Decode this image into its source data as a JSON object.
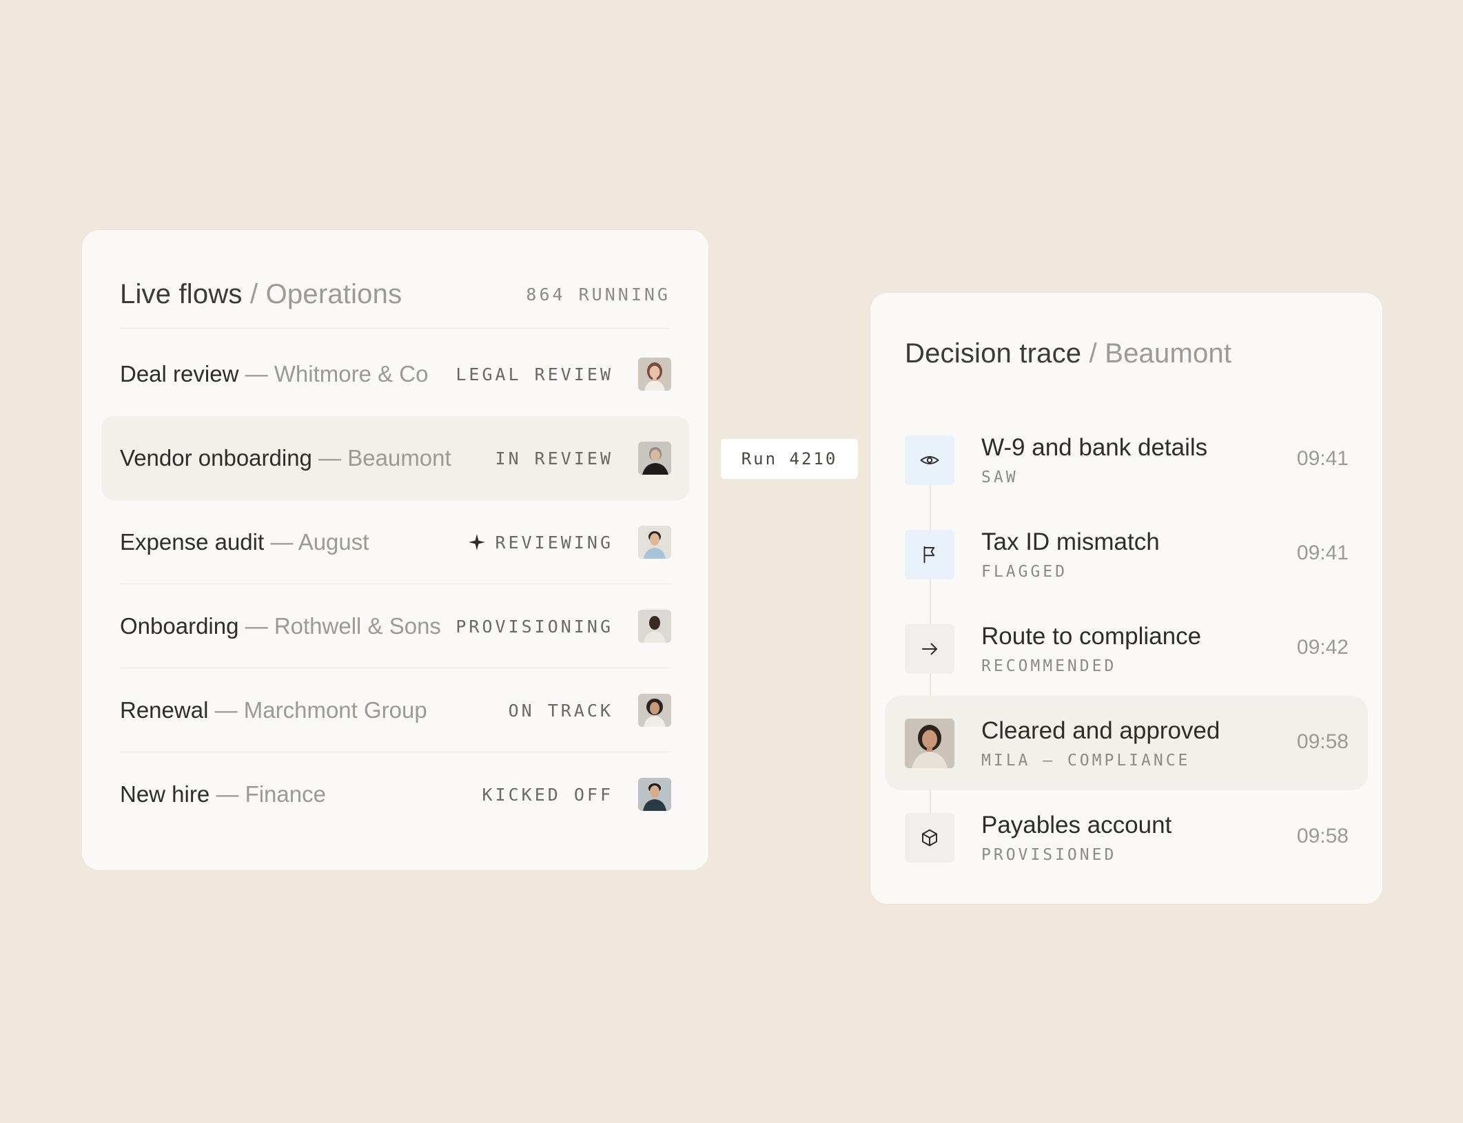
{
  "flows": {
    "title": "Live flows",
    "separator": "/",
    "subtitle": "Operations",
    "running_count": "864 RUNNING",
    "items": [
      {
        "name": "Deal review",
        "dash": "—",
        "org": "Whitmore & Co",
        "status": "LEGAL REVIEW"
      },
      {
        "name": "Vendor onboarding",
        "dash": "—",
        "org": "Beaumont",
        "status": "IN REVIEW"
      },
      {
        "name": "Expense audit",
        "dash": "—",
        "org": "August",
        "status": "REVIEWING"
      },
      {
        "name": "Onboarding",
        "dash": "—",
        "org": "Rothwell & Sons",
        "status": "PROVISIONING"
      },
      {
        "name": "Renewal",
        "dash": "—",
        "org": "Marchmont Group",
        "status": "ON TRACK"
      },
      {
        "name": "New hire",
        "dash": "—",
        "org": "Finance",
        "status": "KICKED OFF"
      }
    ]
  },
  "connector": {
    "label": "Run 4210"
  },
  "trace": {
    "title": "Decision trace",
    "separator": "/",
    "subtitle": "Beaumont",
    "items": [
      {
        "title": "W-9 and bank details",
        "sub": "SAW",
        "time": "09:41",
        "icon": "eye-icon"
      },
      {
        "title": "Tax ID mismatch",
        "sub": "FLAGGED",
        "time": "09:41",
        "icon": "flag-icon"
      },
      {
        "title": "Route to compliance",
        "sub": "RECOMMENDED",
        "time": "09:42",
        "icon": "arrow-right-icon"
      },
      {
        "title": "Cleared and approved",
        "sub": "MILA — COMPLIANCE",
        "time": "09:58",
        "icon": "avatar-photo"
      },
      {
        "title": "Payables account",
        "sub": "PROVISIONED",
        "time": "09:58",
        "icon": "cube-icon"
      }
    ]
  },
  "colors": {
    "background": "#f0e7dd",
    "card": "#faf9f7",
    "highlight_row": "#f2f0eb",
    "icon_blue_tint": "#e9f1fb",
    "muted_text": "#9d9993"
  }
}
